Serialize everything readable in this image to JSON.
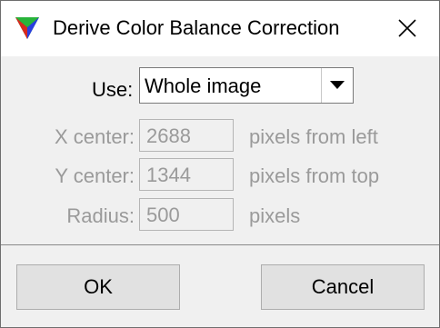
{
  "window": {
    "title": "Derive Color Balance Correction",
    "icon": "rgb-triangle-icon",
    "close_icon": "close-icon"
  },
  "form": {
    "use_label": "Use:",
    "use_value": "Whole image",
    "x_center_label": "X center:",
    "x_center_value": "2688",
    "x_center_unit": "pixels from left",
    "y_center_label": "Y center:",
    "y_center_value": "1344",
    "y_center_unit": "pixels from top",
    "radius_label": "Radius:",
    "radius_value": "500",
    "radius_unit": "pixels"
  },
  "buttons": {
    "ok": "OK",
    "cancel": "Cancel"
  },
  "colors": {
    "disabled_text": "#9a9a9a",
    "button_face": "#e1e1e1",
    "dialog_background": "#f0f0f0"
  }
}
